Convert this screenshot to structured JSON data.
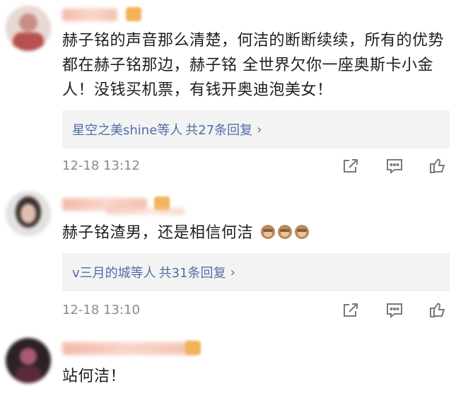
{
  "comments": [
    {
      "text": "赫子铭的声音那么清楚，何洁的断断续续，所有的优势都在赫子铭那边，赫子铭 全世界欠你一座奥斯卡小金人！没钱买机票，有钱开奥迪泡美女！",
      "reply_names": "星空之美shine等人",
      "reply_count": "共27条回复",
      "time": "12-18 13:12"
    },
    {
      "text": "赫子铭渣男，还是相信何洁",
      "emoji": [
        "monkey-see-no-evil",
        "monkey-see-no-evil",
        "monkey-see-no-evil"
      ],
      "reply_names": "v三月的城等人",
      "reply_count": "共31条回复",
      "time": "12-18 13:10"
    },
    {
      "text": "站何洁！"
    }
  ],
  "icons": {
    "reply_arrow": "chevron-right-icon",
    "share": "share-icon",
    "comment": "comment-icon",
    "like": "thumbs-up-icon"
  },
  "colors": {
    "link": "#4f6fa8",
    "time": "#8a8a8a",
    "reply_bg": "#f3f3f3"
  }
}
